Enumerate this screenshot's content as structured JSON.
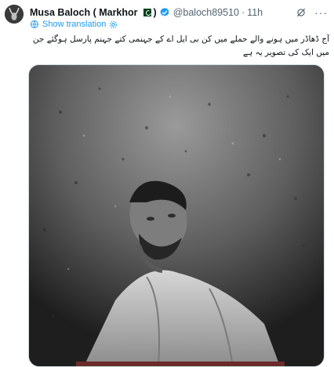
{
  "tweet": {
    "author_name": "Musa Baloch ( Markhor",
    "author_name_close": ")",
    "handle": "@baloch89510",
    "separator": "·",
    "time": "11h",
    "show_translation": "Show translation",
    "text": "آج ڈھاڈر میں ہونے والے حملے میں کن بی ایل اے کے جہنمی کتے جہنم پارسل ہوگئے جن میں ایک کی تصویر یہ ہے"
  },
  "colors": {
    "link": "#1d9bf0",
    "secondary_text": "#536471",
    "flag_green": "#01411c",
    "photo_tone": "#4b4b4b"
  },
  "icons": {
    "avatar": "avatar-markhor",
    "verified": "verified-badge-icon",
    "flag": "pakistan-flag-icon",
    "grok": "grok-icon",
    "more": "more-options-icon",
    "globe": "globe-icon",
    "settings": "settings-icon"
  }
}
